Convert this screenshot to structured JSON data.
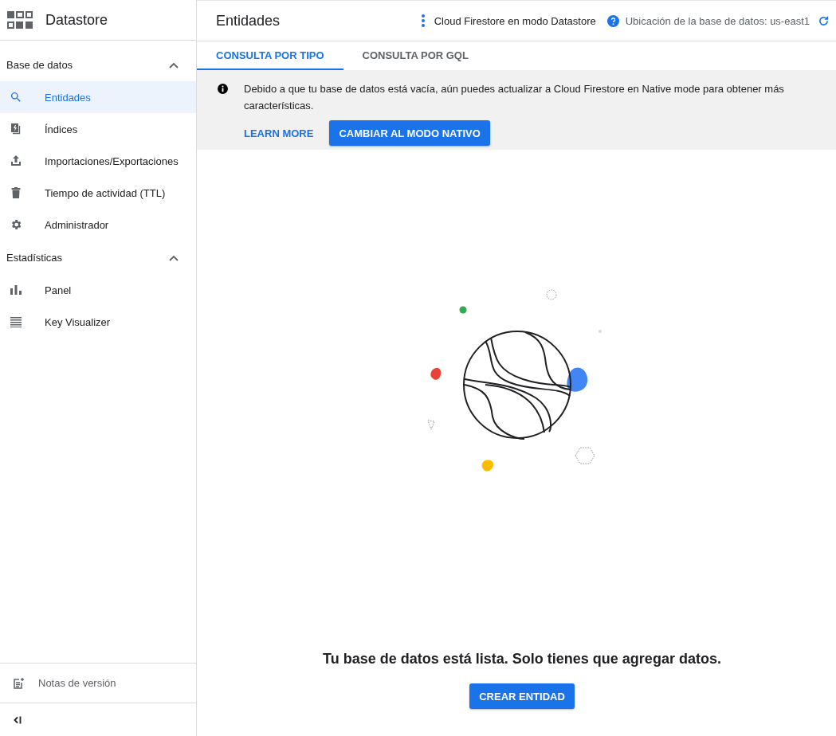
{
  "app": {
    "title": "Datastore"
  },
  "sidebar": {
    "sections": [
      {
        "title": "Base de datos",
        "expanded": true,
        "items": [
          {
            "label": "Entidades",
            "kind": "search",
            "selected": true
          },
          {
            "label": "Índices",
            "kind": "index",
            "selected": false
          },
          {
            "label": "Importaciones/Exportaciones",
            "kind": "upload",
            "selected": false
          },
          {
            "label": "Tiempo de actividad (TTL)",
            "kind": "trash",
            "selected": false
          },
          {
            "label": "Administrador",
            "kind": "gear",
            "selected": false
          }
        ]
      },
      {
        "title": "Estadísticas",
        "expanded": true,
        "items": [
          {
            "label": "Panel",
            "kind": "bars",
            "selected": false
          },
          {
            "label": "Key Visualizer",
            "kind": "grid",
            "selected": false
          }
        ]
      }
    ],
    "footer": {
      "label": "Notas de versión"
    }
  },
  "header": {
    "title": "Entidades",
    "mode": "Cloud Firestore en modo Datastore",
    "location": "Ubicación de la base de datos: us-east1"
  },
  "tabs": [
    {
      "label": "CONSULTA POR TIPO",
      "selected": true
    },
    {
      "label": "CONSULTA POR GQL",
      "selected": false
    }
  ],
  "banner": {
    "message": "Debido a que tu base de datos está vacía, aún puedes actualizar a Cloud Firestore en Native mode para obtener más características.",
    "link": "LEARN MORE",
    "button": "CAMBIAR AL MODO NATIVO"
  },
  "empty_state": {
    "message": "Tu base de datos está lista. Solo tienes que agregar datos.",
    "button": "CREAR ENTIDAD"
  }
}
